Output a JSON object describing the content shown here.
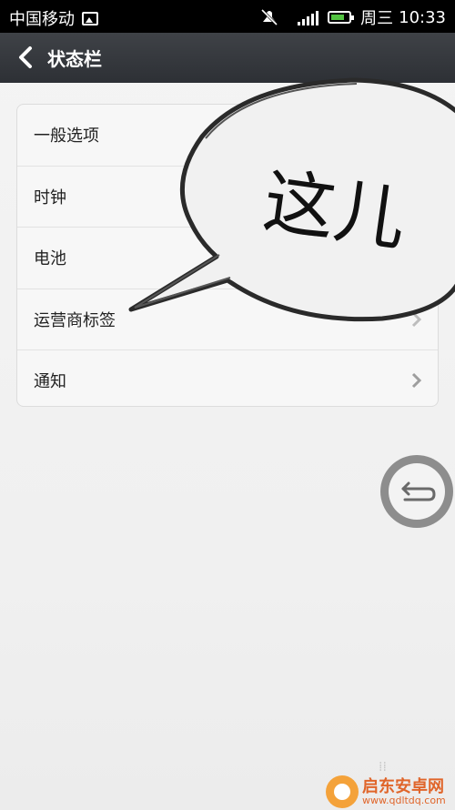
{
  "status_bar": {
    "carrier": "中国移动",
    "weekday": "周三",
    "time": "10:33",
    "icons": [
      "image-icon",
      "mute-icon",
      "signal-icon",
      "battery-icon"
    ],
    "battery_color": "#52c341"
  },
  "header": {
    "title": "状态栏",
    "back_icon": "chevron-left-icon"
  },
  "list": {
    "items": [
      {
        "label": "一般选项"
      },
      {
        "label": "时钟"
      },
      {
        "label": "电池"
      },
      {
        "label": "运营商标签"
      },
      {
        "label": "通知"
      }
    ]
  },
  "annotation": {
    "bubble_text": "这儿"
  },
  "floating_button": {
    "icon": "return-arrow-icon"
  },
  "watermark": {
    "brand": "启东安卓网",
    "url": "www.qdltdq.com"
  }
}
